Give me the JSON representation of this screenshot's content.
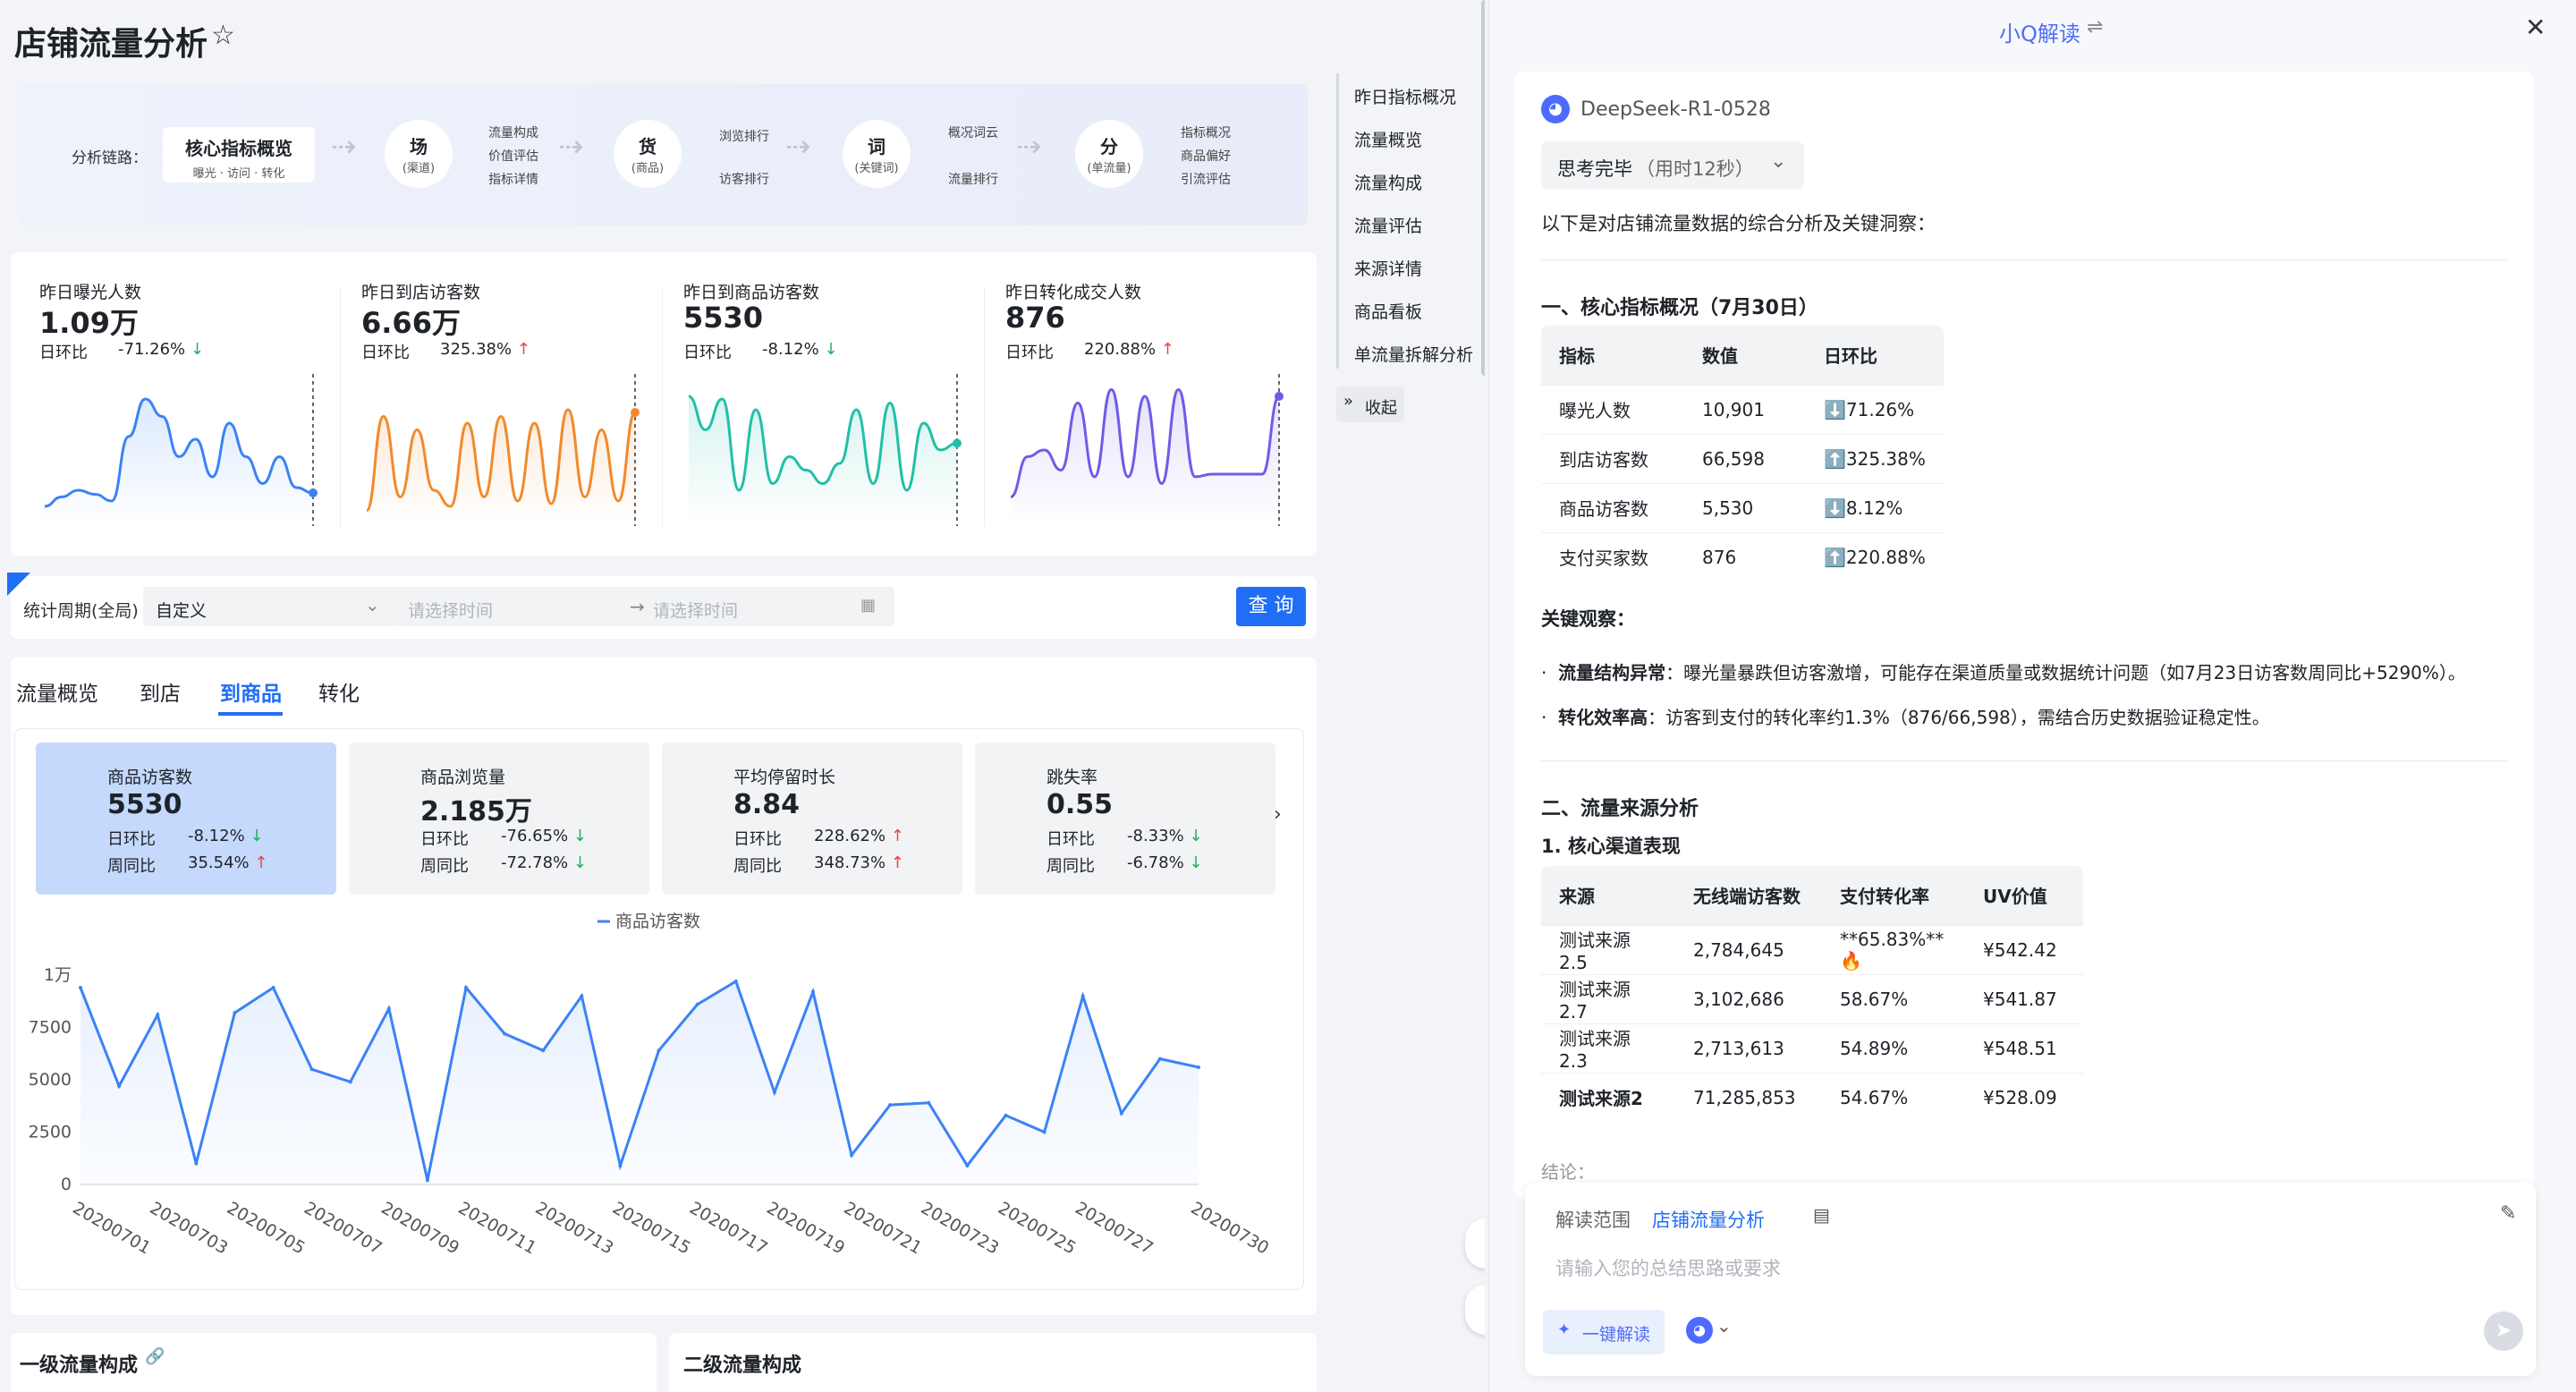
{
  "page": {
    "title": "店铺流量分析"
  },
  "chain": {
    "label": "分析链路：",
    "core": {
      "title": "核心指标概览",
      "sub": "曝光 · 访问 · 转化"
    },
    "nodes": [
      {
        "title": "场",
        "sub": "(渠道)",
        "leaves": [
          "流量构成",
          "价值评估",
          "指标详情"
        ]
      },
      {
        "title": "货",
        "sub": "(商品)",
        "leaves": [
          "浏览排行",
          "访客排行"
        ]
      },
      {
        "title": "词",
        "sub": "(关键词)",
        "leaves": [
          "概况词云",
          "流量排行"
        ]
      },
      {
        "title": "分",
        "sub": "(单流量)",
        "leaves": [
          "指标概况",
          "商品偏好",
          "引流评估"
        ]
      }
    ]
  },
  "metrics": [
    {
      "label": "昨日曝光人数",
      "value": "1.09万",
      "cmp_label": "日环比",
      "cmp": "-71.26%",
      "dir": "down",
      "color": "#3b82f6",
      "points": [
        0.92,
        0.85,
        0.8,
        0.83,
        0.88,
        0.4,
        0.12,
        0.25,
        0.55,
        0.42,
        0.7,
        0.3,
        0.55,
        0.75,
        0.55,
        0.78,
        0.82
      ]
    },
    {
      "label": "昨日到店访客数",
      "value": "6.66万",
      "cmp_label": "日环比",
      "cmp": "325.38%",
      "dir": "up",
      "color": "#f28a2b",
      "points": [
        0.95,
        0.25,
        0.85,
        0.35,
        0.8,
        0.92,
        0.3,
        0.85,
        0.25,
        0.88,
        0.3,
        0.9,
        0.2,
        0.85,
        0.35,
        0.88,
        0.22
      ]
    },
    {
      "label": "昨日到商品访客数",
      "value": "5530",
      "cmp_label": "日环比",
      "cmp": "-8.12%",
      "dir": "down",
      "color": "#20c0a8",
      "points": [
        0.1,
        0.35,
        0.12,
        0.8,
        0.2,
        0.75,
        0.55,
        0.65,
        0.75,
        0.6,
        0.2,
        0.75,
        0.15,
        0.8,
        0.3,
        0.5,
        0.45
      ]
    },
    {
      "label": "昨日转化成交人数",
      "value": "876",
      "cmp_label": "日环比",
      "cmp": "220.88%",
      "dir": "up",
      "color": "#6d5ce8",
      "points": [
        0.85,
        0.55,
        0.5,
        0.65,
        0.15,
        0.7,
        0.05,
        0.7,
        0.1,
        0.75,
        0.05,
        0.7,
        0.68,
        0.68,
        0.68,
        0.68,
        0.1
      ]
    }
  ],
  "filter": {
    "label": "统计周期(全局)",
    "select_value": "自定义",
    "start_placeholder": "请选择时间",
    "end_placeholder": "请选择时间",
    "query": "查 询"
  },
  "tabs": [
    "流量概览",
    "到店",
    "到商品",
    "转化"
  ],
  "kpis": [
    {
      "label": "商品访客数",
      "value": "5530",
      "d_label": "日环比",
      "d": "-8.12%",
      "d_dir": "down",
      "w_label": "周同比",
      "w": "35.54%",
      "w_dir": "up"
    },
    {
      "label": "商品浏览量",
      "value": "2.185万",
      "d_label": "日环比",
      "d": "-76.65%",
      "d_dir": "down",
      "w_label": "周同比",
      "w": "-72.78%",
      "w_dir": "down"
    },
    {
      "label": "平均停留时长",
      "value": "8.84",
      "d_label": "日环比",
      "d": "228.62%",
      "d_dir": "up",
      "w_label": "周同比",
      "w": "348.73%",
      "w_dir": "up"
    },
    {
      "label": "跳失率",
      "value": "0.55",
      "d_label": "日环比",
      "d": "-8.33%",
      "d_dir": "down",
      "w_label": "周同比",
      "w": "-6.78%",
      "w_dir": "down"
    }
  ],
  "chart_data": {
    "type": "line",
    "series": [
      {
        "name": "商品访客数",
        "values": [
          9400,
          4700,
          8100,
          1000,
          8200,
          9400,
          5500,
          4900,
          8400,
          200,
          9400,
          7200,
          6400,
          9000,
          900,
          6400,
          8600,
          9700,
          4400,
          9200,
          1400,
          3800,
          3900,
          900,
          3300,
          2500,
          9000,
          3400,
          6000,
          5600
        ]
      }
    ],
    "x": [
      "20200701",
      "20200702",
      "20200703",
      "20200704",
      "20200705",
      "20200706",
      "20200707",
      "20200708",
      "20200709",
      "20200710",
      "20200711",
      "20200712",
      "20200713",
      "20200714",
      "20200715",
      "20200716",
      "20200717",
      "20200718",
      "20200719",
      "20200720",
      "20200721",
      "20200722",
      "20200723",
      "20200724",
      "20200725",
      "20200726",
      "20200727",
      "20200728",
      "20200729",
      "20200730"
    ],
    "xticks": [
      "20200701",
      "20200703",
      "20200705",
      "20200707",
      "20200709",
      "20200711",
      "20200713",
      "20200715",
      "20200717",
      "20200719",
      "20200721",
      "20200723",
      "20200725",
      "20200727",
      "20200730"
    ],
    "yticks": [
      "0",
      "2500",
      "5000",
      "7500",
      "1万"
    ],
    "ylim": [
      0,
      10000
    ],
    "legend": "top-center",
    "color": "#3b82f6"
  },
  "bottom": {
    "left_title": "一级流量构成",
    "right_title": "二级流量构成"
  },
  "nav": [
    "昨日指标概况",
    "流量概览",
    "流量构成",
    "流量评估",
    "来源详情",
    "商品看板",
    "单流量拆解分析"
  ],
  "collapse": "收起",
  "panel": {
    "title": "小Q解读",
    "model": "DeepSeek-R1-0528",
    "thinking": "思考完毕",
    "thinking_time": "（用时12秒）",
    "intro": "以下是对店铺流量数据的综合分析及关键洞察：",
    "s1_title": "一、核心指标概况（7月30日）",
    "t1_head": [
      "指标",
      "数值",
      "日环比"
    ],
    "t1_rows": [
      [
        "曝光人数",
        "10,901",
        "⬇️71.26%"
      ],
      [
        "到店访客数",
        "66,598",
        "⬆️325.38%"
      ],
      [
        "商品访客数",
        "5,530",
        "⬇️8.12%"
      ],
      [
        "支付买家数",
        "876",
        "⬆️220.88%"
      ]
    ],
    "obs_title": "关键观察：",
    "obs1_b": "流量结构异常",
    "obs1": "：曝光量暴跌但访客激增，可能存在渠道质量或数据统计问题（如7月23日访客数周同比+5290%）。",
    "obs2_b": "转化效率高",
    "obs2": "：访客到支付的转化率约1.3%（876/66,598），需结合历史数据验证稳定性。",
    "s2_title": "二、流量来源分析",
    "s2_sub": "1. 核心渠道表现",
    "t2_head": [
      "来源",
      "无线端访客数",
      "支付转化率",
      "UV价值"
    ],
    "t2_rows": [
      [
        "测试来源2.5",
        "2,784,645",
        "**65.83%**🔥",
        "¥542.42"
      ],
      [
        "测试来源2.7",
        "3,102,686",
        "58.67%",
        "¥541.87"
      ],
      [
        "测试来源2.3",
        "2,713,613",
        "54.89%",
        "¥548.51"
      ],
      [
        "测试来源2",
        "71,285,853",
        "54.67%",
        "¥528.09"
      ]
    ],
    "conclusion": "结论：",
    "scope_label": "解读范围",
    "scope_value": "店铺流量分析",
    "input_placeholder": "请输入您的总结思路或要求",
    "one_click": "一键解读"
  }
}
